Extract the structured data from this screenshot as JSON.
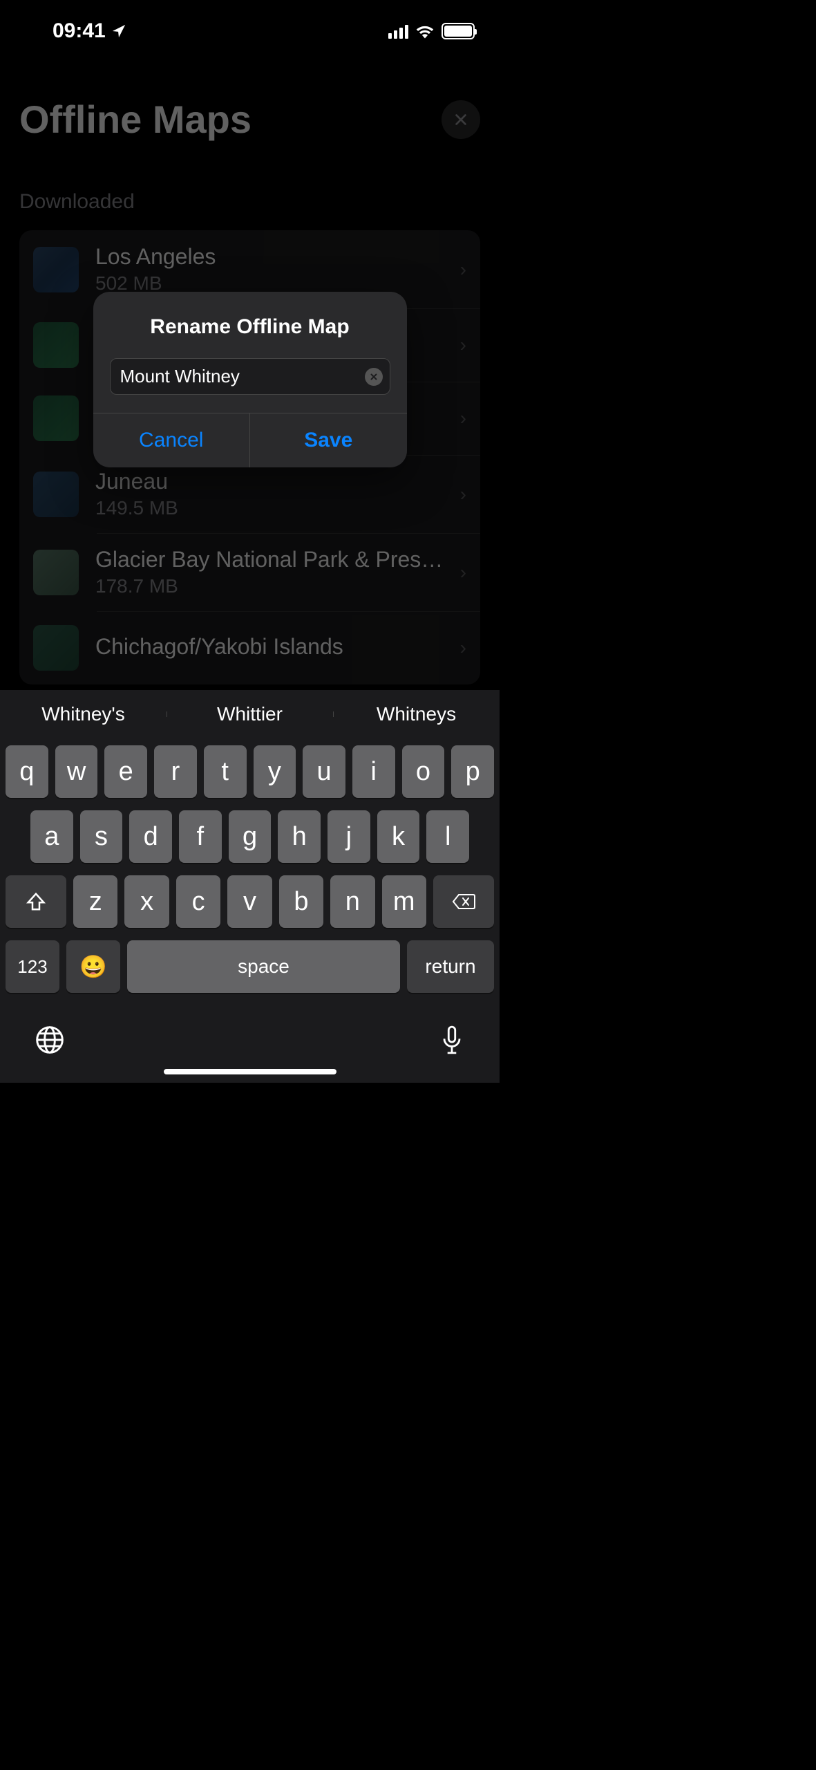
{
  "status": {
    "time": "09:41"
  },
  "page": {
    "title": "Offline Maps",
    "section_label": "Downloaded",
    "maps": [
      {
        "name": "Los Angeles",
        "size": "502 MB"
      },
      {
        "name": "",
        "size": ""
      },
      {
        "name": "",
        "size": ""
      },
      {
        "name": "Juneau",
        "size": "149.5 MB"
      },
      {
        "name": "Glacier Bay National Park & Preser…",
        "size": "178.7 MB"
      },
      {
        "name": "Chichagof/Yakobi Islands",
        "size": ""
      }
    ]
  },
  "dialog": {
    "title": "Rename Offline Map",
    "value": "Mount Whitney",
    "cancel": "Cancel",
    "save": "Save"
  },
  "keyboard": {
    "suggestions": [
      "Whitney's",
      "Whittier",
      "Whitneys"
    ],
    "row1": [
      "q",
      "w",
      "e",
      "r",
      "t",
      "y",
      "u",
      "i",
      "o",
      "p"
    ],
    "row2": [
      "a",
      "s",
      "d",
      "f",
      "g",
      "h",
      "j",
      "k",
      "l"
    ],
    "row3": [
      "z",
      "x",
      "c",
      "v",
      "b",
      "n",
      "m"
    ],
    "numkey": "123",
    "space": "space",
    "return": "return"
  }
}
